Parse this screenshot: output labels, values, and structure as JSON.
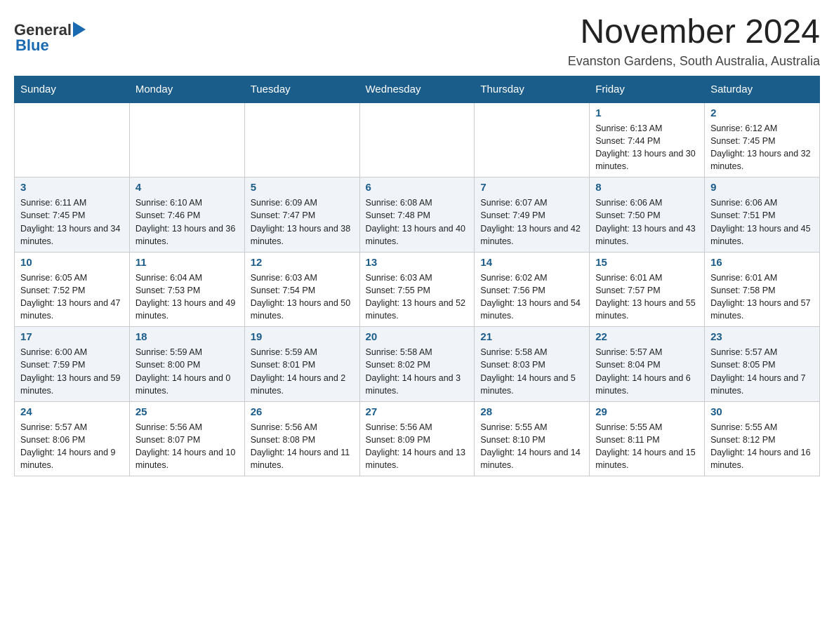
{
  "header": {
    "logo_general": "General",
    "logo_blue": "Blue",
    "month_title": "November 2024",
    "subtitle": "Evanston Gardens, South Australia, Australia"
  },
  "calendar": {
    "days_of_week": [
      "Sunday",
      "Monday",
      "Tuesday",
      "Wednesday",
      "Thursday",
      "Friday",
      "Saturday"
    ],
    "weeks": [
      [
        {
          "day": "",
          "info": ""
        },
        {
          "day": "",
          "info": ""
        },
        {
          "day": "",
          "info": ""
        },
        {
          "day": "",
          "info": ""
        },
        {
          "day": "",
          "info": ""
        },
        {
          "day": "1",
          "info": "Sunrise: 6:13 AM\nSunset: 7:44 PM\nDaylight: 13 hours and 30 minutes."
        },
        {
          "day": "2",
          "info": "Sunrise: 6:12 AM\nSunset: 7:45 PM\nDaylight: 13 hours and 32 minutes."
        }
      ],
      [
        {
          "day": "3",
          "info": "Sunrise: 6:11 AM\nSunset: 7:45 PM\nDaylight: 13 hours and 34 minutes."
        },
        {
          "day": "4",
          "info": "Sunrise: 6:10 AM\nSunset: 7:46 PM\nDaylight: 13 hours and 36 minutes."
        },
        {
          "day": "5",
          "info": "Sunrise: 6:09 AM\nSunset: 7:47 PM\nDaylight: 13 hours and 38 minutes."
        },
        {
          "day": "6",
          "info": "Sunrise: 6:08 AM\nSunset: 7:48 PM\nDaylight: 13 hours and 40 minutes."
        },
        {
          "day": "7",
          "info": "Sunrise: 6:07 AM\nSunset: 7:49 PM\nDaylight: 13 hours and 42 minutes."
        },
        {
          "day": "8",
          "info": "Sunrise: 6:06 AM\nSunset: 7:50 PM\nDaylight: 13 hours and 43 minutes."
        },
        {
          "day": "9",
          "info": "Sunrise: 6:06 AM\nSunset: 7:51 PM\nDaylight: 13 hours and 45 minutes."
        }
      ],
      [
        {
          "day": "10",
          "info": "Sunrise: 6:05 AM\nSunset: 7:52 PM\nDaylight: 13 hours and 47 minutes."
        },
        {
          "day": "11",
          "info": "Sunrise: 6:04 AM\nSunset: 7:53 PM\nDaylight: 13 hours and 49 minutes."
        },
        {
          "day": "12",
          "info": "Sunrise: 6:03 AM\nSunset: 7:54 PM\nDaylight: 13 hours and 50 minutes."
        },
        {
          "day": "13",
          "info": "Sunrise: 6:03 AM\nSunset: 7:55 PM\nDaylight: 13 hours and 52 minutes."
        },
        {
          "day": "14",
          "info": "Sunrise: 6:02 AM\nSunset: 7:56 PM\nDaylight: 13 hours and 54 minutes."
        },
        {
          "day": "15",
          "info": "Sunrise: 6:01 AM\nSunset: 7:57 PM\nDaylight: 13 hours and 55 minutes."
        },
        {
          "day": "16",
          "info": "Sunrise: 6:01 AM\nSunset: 7:58 PM\nDaylight: 13 hours and 57 minutes."
        }
      ],
      [
        {
          "day": "17",
          "info": "Sunrise: 6:00 AM\nSunset: 7:59 PM\nDaylight: 13 hours and 59 minutes."
        },
        {
          "day": "18",
          "info": "Sunrise: 5:59 AM\nSunset: 8:00 PM\nDaylight: 14 hours and 0 minutes."
        },
        {
          "day": "19",
          "info": "Sunrise: 5:59 AM\nSunset: 8:01 PM\nDaylight: 14 hours and 2 minutes."
        },
        {
          "day": "20",
          "info": "Sunrise: 5:58 AM\nSunset: 8:02 PM\nDaylight: 14 hours and 3 minutes."
        },
        {
          "day": "21",
          "info": "Sunrise: 5:58 AM\nSunset: 8:03 PM\nDaylight: 14 hours and 5 minutes."
        },
        {
          "day": "22",
          "info": "Sunrise: 5:57 AM\nSunset: 8:04 PM\nDaylight: 14 hours and 6 minutes."
        },
        {
          "day": "23",
          "info": "Sunrise: 5:57 AM\nSunset: 8:05 PM\nDaylight: 14 hours and 7 minutes."
        }
      ],
      [
        {
          "day": "24",
          "info": "Sunrise: 5:57 AM\nSunset: 8:06 PM\nDaylight: 14 hours and 9 minutes."
        },
        {
          "day": "25",
          "info": "Sunrise: 5:56 AM\nSunset: 8:07 PM\nDaylight: 14 hours and 10 minutes."
        },
        {
          "day": "26",
          "info": "Sunrise: 5:56 AM\nSunset: 8:08 PM\nDaylight: 14 hours and 11 minutes."
        },
        {
          "day": "27",
          "info": "Sunrise: 5:56 AM\nSunset: 8:09 PM\nDaylight: 14 hours and 13 minutes."
        },
        {
          "day": "28",
          "info": "Sunrise: 5:55 AM\nSunset: 8:10 PM\nDaylight: 14 hours and 14 minutes."
        },
        {
          "day": "29",
          "info": "Sunrise: 5:55 AM\nSunset: 8:11 PM\nDaylight: 14 hours and 15 minutes."
        },
        {
          "day": "30",
          "info": "Sunrise: 5:55 AM\nSunset: 8:12 PM\nDaylight: 14 hours and 16 minutes."
        }
      ]
    ]
  }
}
